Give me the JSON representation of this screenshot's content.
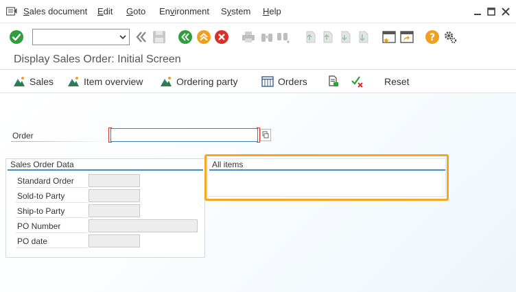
{
  "menu": {
    "items": [
      {
        "label": "Sales document",
        "underline": "S"
      },
      {
        "label": "Edit",
        "underline": "E"
      },
      {
        "label": "Goto",
        "underline": "G"
      },
      {
        "label": "Environment",
        "underline": "v"
      },
      {
        "label": "System",
        "underline": "y"
      },
      {
        "label": "Help",
        "underline": "H"
      }
    ]
  },
  "toolbar": {
    "command_value": "",
    "icons": [
      "enter-icon",
      "back-icon",
      "save-icon",
      "back-green-icon",
      "exit-icon",
      "cancel-icon",
      "print-icon",
      "find-icon",
      "find-next-icon",
      "first-page-icon",
      "previous-page-icon",
      "next-page-icon",
      "last-page-icon",
      "new-session-icon",
      "shortcut-icon",
      "help-icon",
      "settings-icon"
    ]
  },
  "title": "Display Sales Order: Initial Screen",
  "app_toolbar": {
    "sales": "Sales",
    "item_overview": "Item overview",
    "ordering_party": "Ordering party",
    "orders": "Orders",
    "reset": "Reset"
  },
  "order": {
    "label": "Order",
    "value": ""
  },
  "sales_order_data": {
    "title": "Sales Order Data",
    "fields": [
      {
        "label": "Standard Order",
        "value": ""
      },
      {
        "label": "Sold-to Party",
        "value": ""
      },
      {
        "label": "Ship-to Party",
        "value": ""
      },
      {
        "label": "PO Number",
        "value": ""
      },
      {
        "label": "PO date",
        "value": ""
      }
    ]
  },
  "all_items": {
    "title": "All items"
  },
  "colors": {
    "accent_blue": "#3d8fd1",
    "enter_green": "#2e9e3f",
    "cancel_red": "#d9302b",
    "help_orange": "#f0a020",
    "highlight_orange": "#f5a623"
  }
}
